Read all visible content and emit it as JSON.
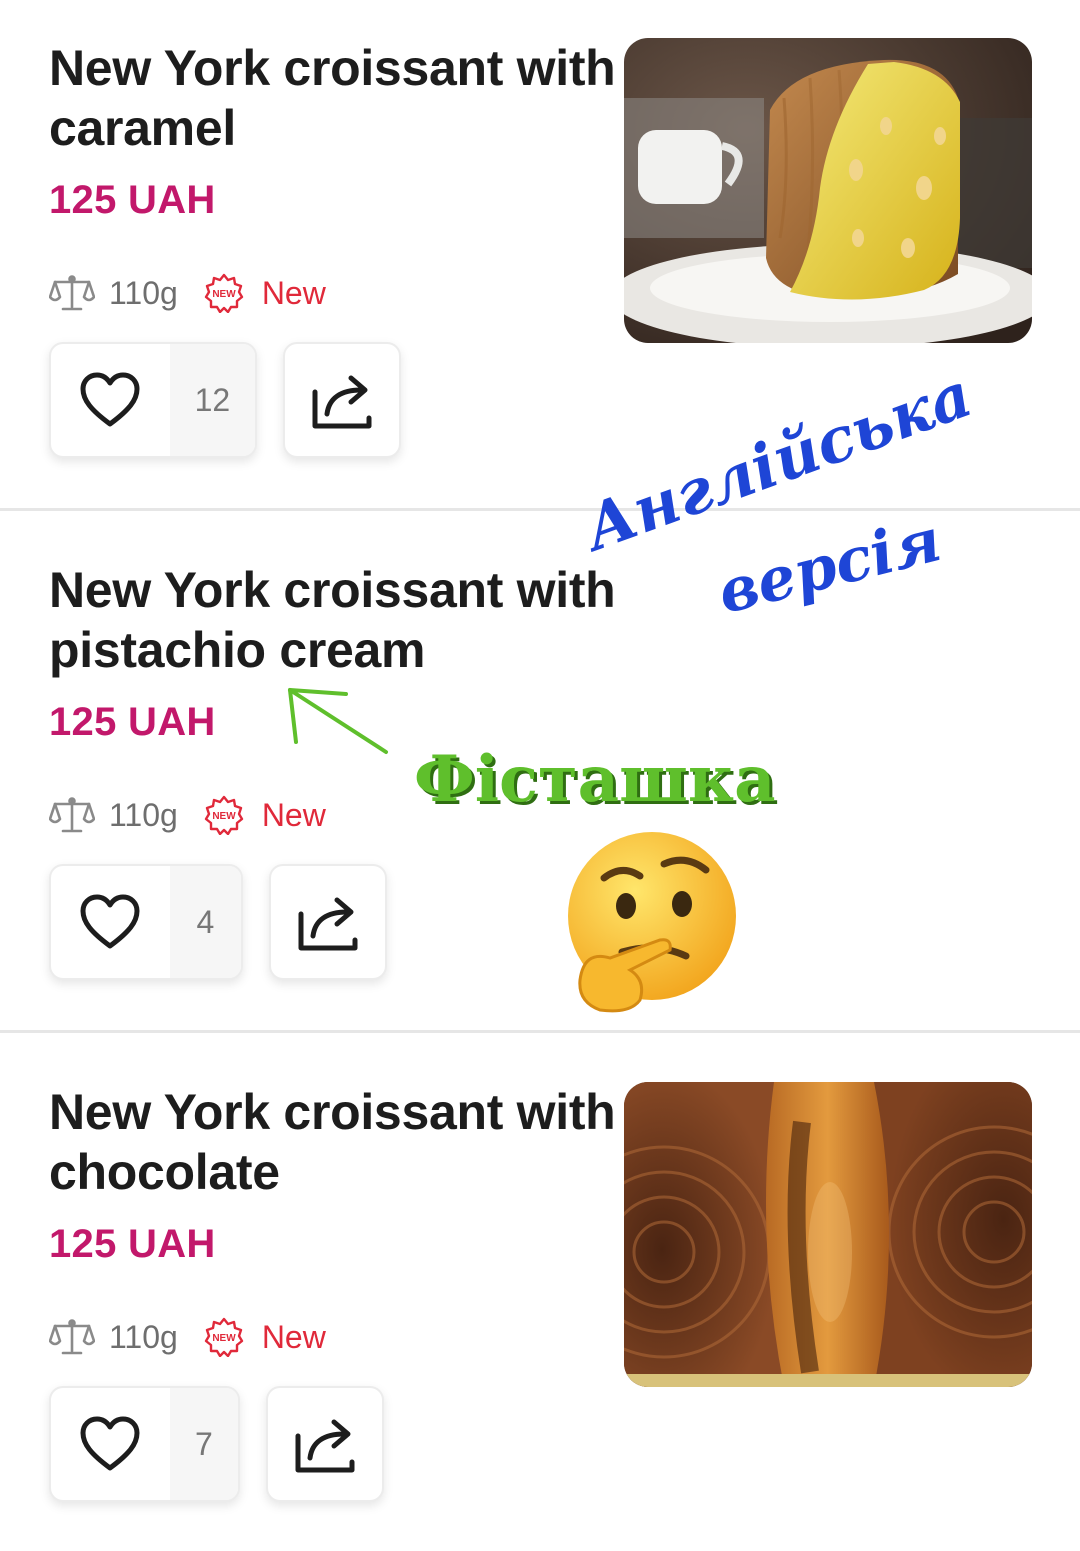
{
  "items": [
    {
      "title": "New York croissant with caramel",
      "price": "125 UAH",
      "weight": "110g",
      "badge": "New",
      "likes": "12",
      "image": "caramel-croissant"
    },
    {
      "title": "New York croissant with pistachio cream",
      "price": "125 UAH",
      "weight": "110g",
      "badge": "New",
      "likes": "4"
    },
    {
      "title": "New York croissant with chocolate",
      "price": "125 UAH",
      "weight": "110g",
      "badge": "New",
      "likes": "7",
      "image": "chocolate-croissant"
    }
  ],
  "annotations": {
    "line1": "Англійська",
    "line2": "версія",
    "pistachio": "Фісташка",
    "emoji": "🤔"
  },
  "colors": {
    "price": "#c2186b",
    "badge": "#e0293a",
    "annotation_blue": "#1e45d6",
    "annotation_green": "#5fbf2c"
  },
  "icons": {
    "weight": "scale-icon",
    "badge": "new-badge-icon",
    "like": "heart-icon",
    "share": "share-icon"
  }
}
